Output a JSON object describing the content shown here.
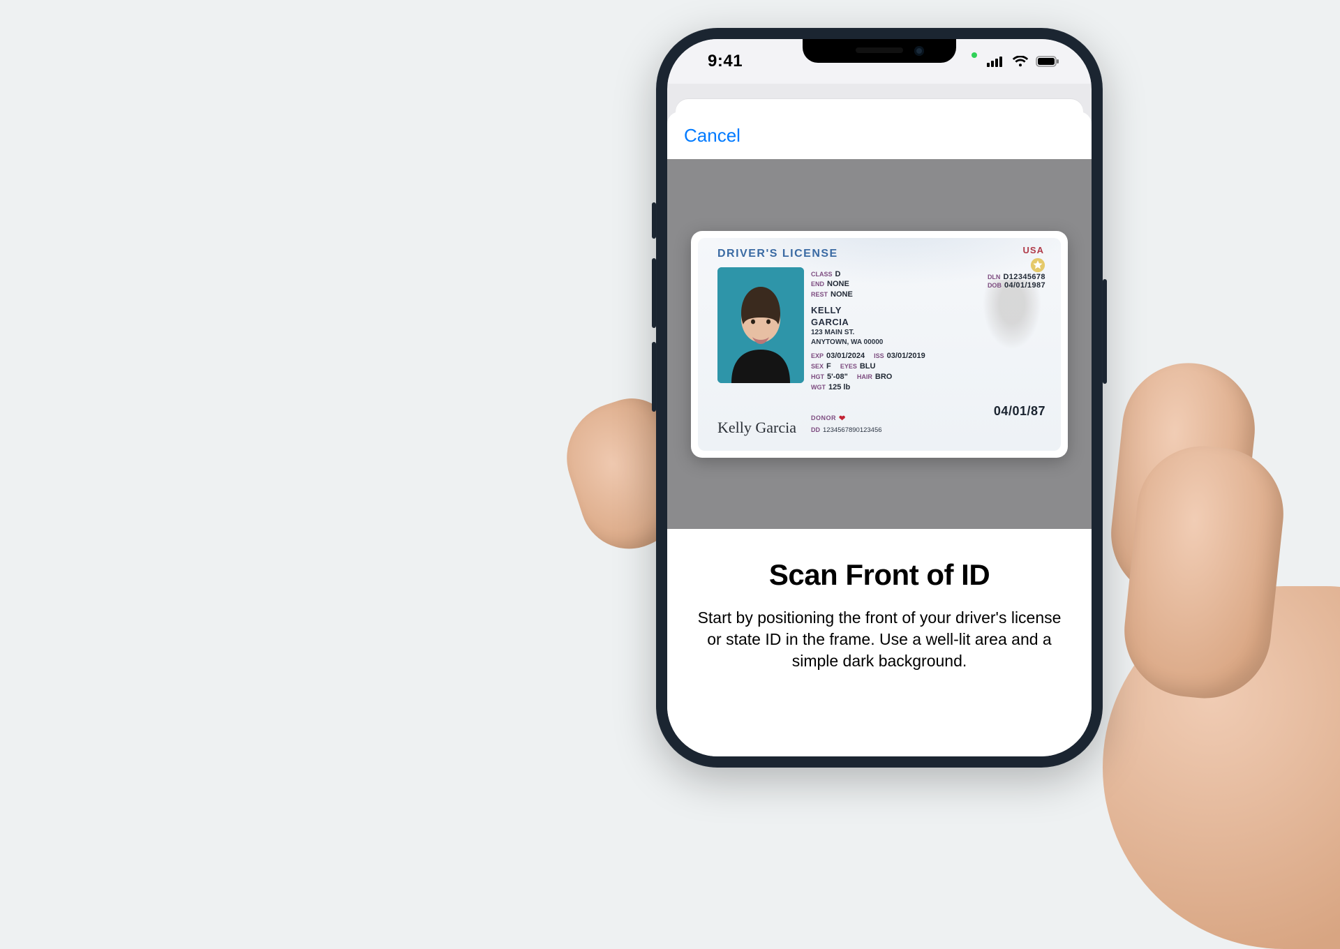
{
  "status": {
    "time": "9:41"
  },
  "nav": {
    "cancel": "Cancel"
  },
  "license": {
    "title": "DRIVER'S LICENSE",
    "country": "USA",
    "class_lbl": "CLASS",
    "class_val": "D",
    "end_lbl": "END",
    "end_val": "NONE",
    "rest_lbl": "REST",
    "rest_val": "NONE",
    "name_last": "KELLY",
    "name_first": "GARCIA",
    "addr1": "123 MAIN ST.",
    "addr2": "ANYTOWN, WA 00000",
    "exp_lbl": "EXP",
    "exp_val": "03/01/2024",
    "iss_lbl": "ISS",
    "iss_val": "03/01/2019",
    "sex_lbl": "SEX",
    "sex_val": "F",
    "eyes_lbl": "EYES",
    "eyes_val": "BLU",
    "hgt_lbl": "HGT",
    "hgt_val": "5'-08\"",
    "hair_lbl": "HAIR",
    "hair_val": "BRO",
    "wgt_lbl": "WGT",
    "wgt_val": "125 lb",
    "dln_lbl": "DLN",
    "dln_val": "D12345678",
    "dob_lbl": "DOB",
    "dob_val": "04/01/1987",
    "big_dob": "04/01/87",
    "donor_lbl": "DONOR",
    "dd_lbl": "DD",
    "dd_val": "1234567890123456",
    "signature": "Kelly Garcia"
  },
  "instruction": {
    "title": "Scan Front of ID",
    "body": "Start by positioning the front of your driver's license or state ID in the frame. Use a well-lit area and a simple dark background."
  }
}
